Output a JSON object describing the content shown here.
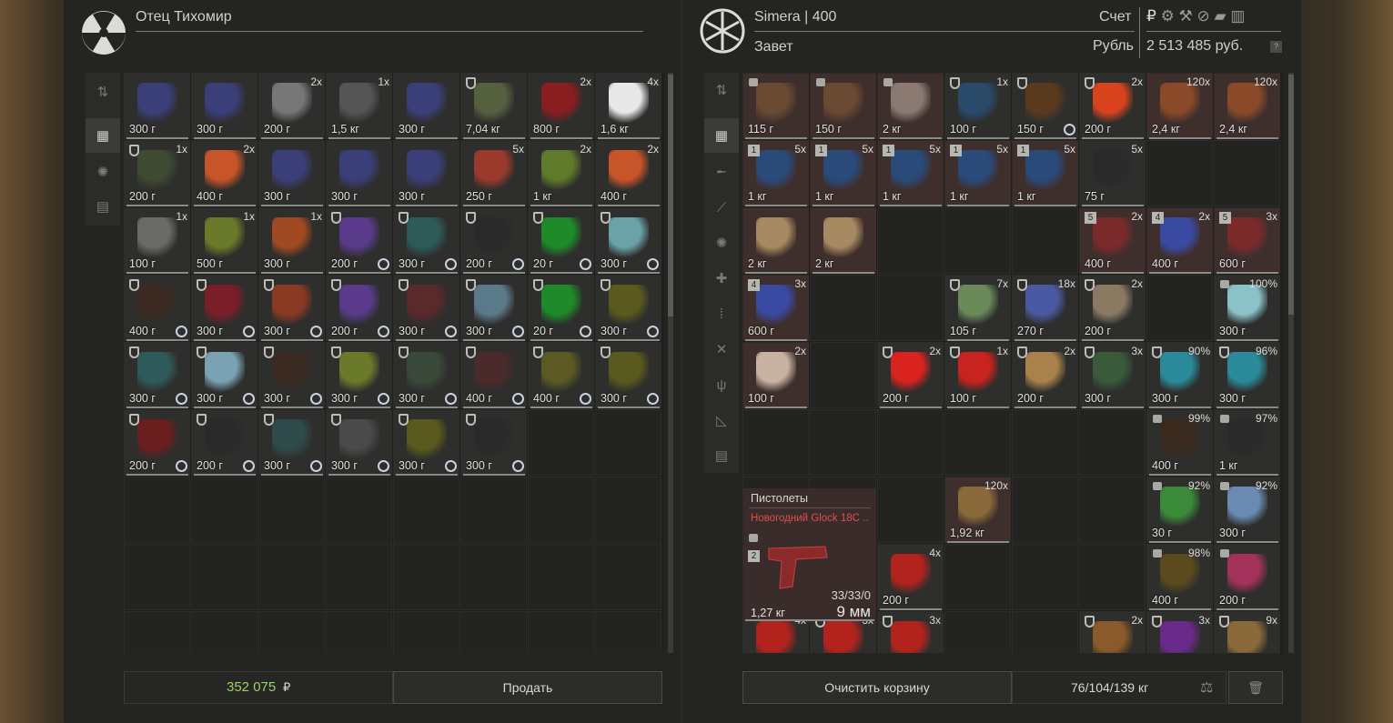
{
  "trader": {
    "name": "Отец Тихомир",
    "logo_icon": "radiation-icon",
    "total": "352 075",
    "currency_symbol": "₽",
    "sell_label": "Продать",
    "items": [
      {
        "w": "300 г",
        "c": "",
        "k": "book",
        "color": "#3a3f7a"
      },
      {
        "w": "300 г",
        "c": "",
        "k": "book",
        "color": "#3a3f7a"
      },
      {
        "w": "200 г",
        "c": "2x",
        "k": "transistor",
        "color": "#777"
      },
      {
        "w": "1,5 кг",
        "c": "1x",
        "k": "plate",
        "color": "#555"
      },
      {
        "w": "300 г",
        "c": "",
        "k": "book",
        "color": "#3a3f7a"
      },
      {
        "w": "7,04 кг",
        "c": "",
        "k": "camo",
        "color": "#55603f",
        "s": true
      },
      {
        "w": "800 г",
        "c": "2x",
        "k": "red-spikes",
        "color": "#8a1e1e"
      },
      {
        "w": "1,6 кг",
        "c": "4x",
        "k": "white-stone",
        "color": "#e8e8e8"
      },
      {
        "w": "200 г",
        "c": "1x",
        "k": "device",
        "color": "#3e4a32",
        "s": true
      },
      {
        "w": "400 г",
        "c": "2x",
        "k": "cube",
        "color": "#c8542a"
      },
      {
        "w": "300 г",
        "c": "",
        "k": "book",
        "color": "#3a3f7a"
      },
      {
        "w": "300 г",
        "c": "",
        "k": "book",
        "color": "#3a3f7a"
      },
      {
        "w": "300 г",
        "c": "",
        "k": "book",
        "color": "#3a3f7a"
      },
      {
        "w": "250 г",
        "c": "5x",
        "k": "chip",
        "color": "#9a3a2c"
      },
      {
        "w": "1 кг",
        "c": "2x",
        "k": "mine",
        "color": "#5e7a2a"
      },
      {
        "w": "400 г",
        "c": "2x",
        "k": "cube",
        "color": "#c8542a"
      },
      {
        "w": "100 г",
        "c": "1x",
        "k": "paper",
        "color": "#6a6a66"
      },
      {
        "w": "500 г",
        "c": "1x",
        "k": "mine",
        "color": "#6a7a2a"
      },
      {
        "w": "300 г",
        "c": "1x",
        "k": "claw",
        "color": "#a14a22"
      },
      {
        "w": "200 г",
        "c": "",
        "k": "artifact",
        "color": "#5a3a8a",
        "s": true,
        "t": true
      },
      {
        "w": "300 г",
        "c": "",
        "k": "artifact",
        "color": "#2f5a5a",
        "s": true,
        "t": true
      },
      {
        "w": "200 г",
        "c": "",
        "k": "artifact",
        "color": "#2a2a2a",
        "s": true,
        "t": true
      },
      {
        "w": "20 г",
        "c": "",
        "k": "artifact",
        "color": "#1e8a2a",
        "s": true,
        "t": true
      },
      {
        "w": "300 г",
        "c": "",
        "k": "artifact",
        "color": "#6aa2a8",
        "s": true,
        "t": true
      },
      {
        "w": "400 г",
        "c": "",
        "k": "artifact",
        "color": "#3a2a22",
        "s": true,
        "t": true
      },
      {
        "w": "300 г",
        "c": "",
        "k": "artifact",
        "color": "#7a1e2a",
        "s": true,
        "t": true
      },
      {
        "w": "300 г",
        "c": "",
        "k": "artifact",
        "color": "#8a3a22",
        "s": true,
        "t": true
      },
      {
        "w": "200 г",
        "c": "",
        "k": "artifact",
        "color": "#5a3a8a",
        "s": true,
        "t": true
      },
      {
        "w": "300 г",
        "c": "",
        "k": "artifact",
        "color": "#5a2a2a",
        "s": true,
        "t": true
      },
      {
        "w": "300 г",
        "c": "",
        "k": "artifact",
        "color": "#5a7a8a",
        "s": true,
        "t": true
      },
      {
        "w": "20 г",
        "c": "",
        "k": "artifact",
        "color": "#1e8a2a",
        "s": true,
        "t": true
      },
      {
        "w": "300 г",
        "c": "",
        "k": "artifact",
        "color": "#5a5a1e",
        "s": true,
        "t": true
      },
      {
        "w": "300 г",
        "c": "",
        "k": "artifact",
        "color": "#2f5a5a",
        "s": true,
        "t": true
      },
      {
        "w": "300 г",
        "c": "",
        "k": "artifact",
        "color": "#7aa2b2",
        "s": true,
        "t": true
      },
      {
        "w": "300 г",
        "c": "",
        "k": "artifact",
        "color": "#3a2a22",
        "s": true,
        "t": true
      },
      {
        "w": "300 г",
        "c": "",
        "k": "artifact",
        "color": "#6a7a2a",
        "s": true,
        "t": true
      },
      {
        "w": "300 г",
        "c": "",
        "k": "artifact",
        "color": "#3a4a3a",
        "s": true,
        "t": true
      },
      {
        "w": "400 г",
        "c": "",
        "k": "artifact",
        "color": "#4a2a2a",
        "s": true,
        "t": true
      },
      {
        "w": "400 г",
        "c": "",
        "k": "artifact",
        "color": "#5a5a22",
        "s": true,
        "t": true
      },
      {
        "w": "300 г",
        "c": "",
        "k": "artifact",
        "color": "#5a5a1e",
        "s": true,
        "t": true
      },
      {
        "w": "200 г",
        "c": "",
        "k": "artifact",
        "color": "#6a1e1e",
        "s": true,
        "t": true
      },
      {
        "w": "200 г",
        "c": "",
        "k": "artifact",
        "color": "#2a2a2a",
        "s": true,
        "t": true
      },
      {
        "w": "300 г",
        "c": "",
        "k": "artifact",
        "color": "#2f4a4a",
        "s": true,
        "t": true
      },
      {
        "w": "300 г",
        "c": "",
        "k": "artifact",
        "color": "#4a4a4a",
        "s": true,
        "t": true
      },
      {
        "w": "300 г",
        "c": "",
        "k": "artifact",
        "color": "#5a5a1e",
        "s": true,
        "t": true
      },
      {
        "w": "300 г",
        "c": "",
        "k": "artifact",
        "color": "#2a2a2a",
        "s": true,
        "t": true
      }
    ]
  },
  "player": {
    "name": "Simera | 400",
    "faction": "Завет",
    "logo_icon": "snowflake-faction-icon",
    "account_label": "Счет",
    "currency_label": "Рубль",
    "balance": "2 513 485 руб.",
    "help_label": "?",
    "clear_label": "Очистить корзину",
    "weight": "76/104/139 кг",
    "weapon": {
      "category": "Пистолеты",
      "name": "Новогодний Glock 18C ..",
      "badge": "2",
      "ammo": "33/33/0",
      "caliber": "9 мм",
      "weight": "1,27 кг"
    },
    "items": [
      {
        "w": "115 г",
        "c": "",
        "k": "lock",
        "color": "#6a4a32",
        "l": true
      },
      {
        "w": "150 г",
        "c": "",
        "k": "lock",
        "color": "#6a4a32",
        "l": true
      },
      {
        "w": "2 кг",
        "c": "",
        "k": "panel",
        "color": "#8a7a72",
        "l": true
      },
      {
        "w": "100 г",
        "c": "1x",
        "k": "canister",
        "color": "#2a4a6a",
        "s": true
      },
      {
        "w": "150 г",
        "c": "",
        "k": "sausage",
        "color": "#5a3a1e",
        "s": true,
        "t": true
      },
      {
        "w": "200 г",
        "c": "2x",
        "k": "gloves",
        "color": "#d8431e",
        "s": true
      },
      {
        "w": "2,4 кг",
        "c": "120x",
        "k": "ammo",
        "color": "#8a4a2a"
      },
      {
        "w": "2,4 кг",
        "c": "120x",
        "k": "ammo",
        "color": "#8a4a2a"
      },
      {
        "w": "1 кг",
        "c": "5x",
        "k": "medkit",
        "color": "#2a4a7a",
        "b": "1"
      },
      {
        "w": "1 кг",
        "c": "5x",
        "k": "medkit",
        "color": "#2a4a7a",
        "b": "1"
      },
      {
        "w": "1 кг",
        "c": "5x",
        "k": "medkit",
        "color": "#2a4a7a",
        "b": "1"
      },
      {
        "w": "1 кг",
        "c": "5x",
        "k": "medkit",
        "color": "#2a4a7a",
        "b": "1"
      },
      {
        "w": "1 кг",
        "c": "5x",
        "k": "medkit",
        "color": "#2a4a7a",
        "b": "1"
      },
      {
        "w": "75 г",
        "c": "5x",
        "k": "rock",
        "color": "#2a2a2a"
      },
      {
        "w": "2 кг",
        "c": "",
        "k": "plate",
        "color": "#a88a62"
      },
      {
        "w": "2 кг",
        "c": "",
        "k": "plate",
        "color": "#a88a62"
      },
      {
        "w": "400 г",
        "c": "2x",
        "k": "bottle",
        "color": "#7a2a2a",
        "b": "5"
      },
      {
        "w": "400 г",
        "c": "2x",
        "k": "can",
        "color": "#3a4aa2",
        "b": "4"
      },
      {
        "w": "600 г",
        "c": "3x",
        "k": "bottle",
        "color": "#7a2a2a",
        "b": "5"
      },
      {
        "w": "600 г",
        "c": "3x",
        "k": "can",
        "color": "#3a4aa2",
        "b": "4"
      },
      {
        "w": "105 г",
        "c": "7x",
        "k": "leaf",
        "color": "#6a8a5a",
        "s": true
      },
      {
        "w": "270 г",
        "c": "18x",
        "k": "leaf",
        "color": "#4a5aa2",
        "s": true
      },
      {
        "w": "200 г",
        "c": "2x",
        "k": "cloth",
        "color": "#8a7a62",
        "s": true
      },
      {
        "w": "300 г",
        "c": "100%",
        "k": "crystal",
        "color": "#8ac2c8",
        "l": true
      },
      {
        "w": "100 г",
        "c": "2x",
        "k": "bandage",
        "color": "#c8b2a2"
      },
      {
        "w": "200 г",
        "c": "2x",
        "k": "tomato",
        "color": "#d8231e",
        "s": true
      },
      {
        "w": "100 г",
        "c": "1x",
        "k": "jar",
        "color": "#c8231e",
        "s": true
      },
      {
        "w": "200 г",
        "c": "2x",
        "k": "stick",
        "color": "#a8824a",
        "s": true
      },
      {
        "w": "300 г",
        "c": "3x",
        "k": "tarp",
        "color": "#3a5a3a",
        "s": true
      },
      {
        "w": "300 г",
        "c": "90%",
        "k": "crystal",
        "color": "#2a8a9a",
        "s": true
      },
      {
        "w": "300 г",
        "c": "96%",
        "k": "crystal",
        "color": "#2a8a9a",
        "s": true
      },
      {
        "w": "400 г",
        "c": "99%",
        "k": "urchin",
        "color": "#3a2a1e",
        "l": true
      },
      {
        "w": "1 кг",
        "c": "97%",
        "k": "urchin",
        "color": "#2a2a2a",
        "l": true
      },
      {
        "w": "1,92 кг",
        "c": "120x",
        "k": "ammo",
        "color": "#8a6a3a"
      },
      {
        "w": "30 г",
        "c": "92%",
        "k": "artifact",
        "color": "#3a8a3a",
        "l": true
      },
      {
        "w": "300 г",
        "c": "92%",
        "k": "artifact",
        "color": "#6a8ab2",
        "l": true
      },
      {
        "w": "200 г",
        "c": "4x",
        "k": "flare",
        "color": "#b2231e"
      },
      {
        "w": "400 г",
        "c": "98%",
        "k": "urchin",
        "color": "#5a4a1e",
        "l": true
      },
      {
        "w": "200 г",
        "c": "",
        "k": "coral",
        "color": "#a2325a",
        "l": true
      },
      {
        "w": "",
        "c": "4x",
        "k": "flare",
        "color": "#b2231e"
      },
      {
        "w": "",
        "c": "3x",
        "k": "can",
        "color": "#b2231e",
        "s": true
      },
      {
        "w": "",
        "c": "3x",
        "k": "can",
        "color": "#b2231e",
        "s": true
      },
      {
        "w": "",
        "c": "2x",
        "k": "stick",
        "color": "#8a5a2a",
        "s": true
      },
      {
        "w": "",
        "c": "3x",
        "k": "urchin",
        "color": "#6a2a8a",
        "s": true
      },
      {
        "w": "",
        "c": "9x",
        "k": "ammo",
        "color": "#8a6a3a",
        "s": true
      }
    ]
  },
  "currency_icons": [
    "ruble-icon",
    "gear-icon",
    "hammer-icon",
    "ban-icon",
    "bars-icon",
    "ticket-icon"
  ],
  "left_sidebar": [
    "sort-icon",
    "grid-icon",
    "artifact-icon",
    "archive-icon"
  ],
  "right_sidebar": [
    "sort-icon",
    "grid-icon",
    "rifle-icon",
    "knife-icon",
    "artifact-icon",
    "medkit-icon",
    "ammo-icon",
    "tools-icon",
    "food-icon",
    "ruler-icon",
    "archive-icon"
  ]
}
